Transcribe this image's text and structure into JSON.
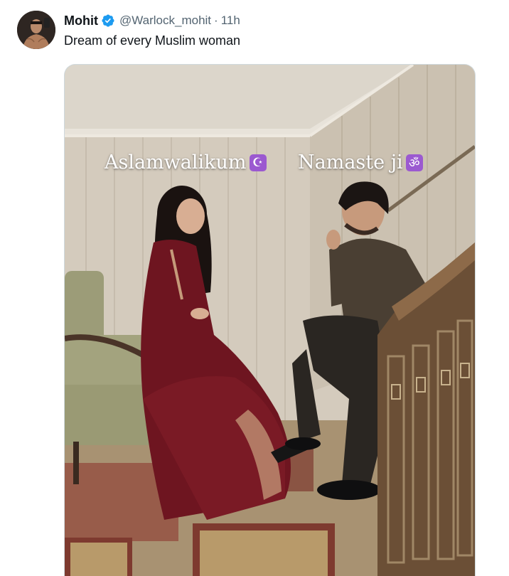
{
  "tweet": {
    "author": {
      "display_name": "Mohit",
      "verified": true,
      "handle": "@Warlock_mohit",
      "separator": "·",
      "time": "11h"
    },
    "text": "Dream of every Muslim woman",
    "media": {
      "overlay_left": {
        "text": "Aslamwalikum",
        "emoji": "☪",
        "emoji_name": "star-and-crescent-icon"
      },
      "overlay_right": {
        "text": "Namaste ji",
        "emoji": "ॐ",
        "emoji_name": "om-icon"
      }
    }
  },
  "colors": {
    "verified_blue": "#1d9bf0",
    "secondary_text": "#536471",
    "primary_text": "#0f1419",
    "emoji_purple": "#9b59d0",
    "dress_maroon": "#6e1520"
  }
}
